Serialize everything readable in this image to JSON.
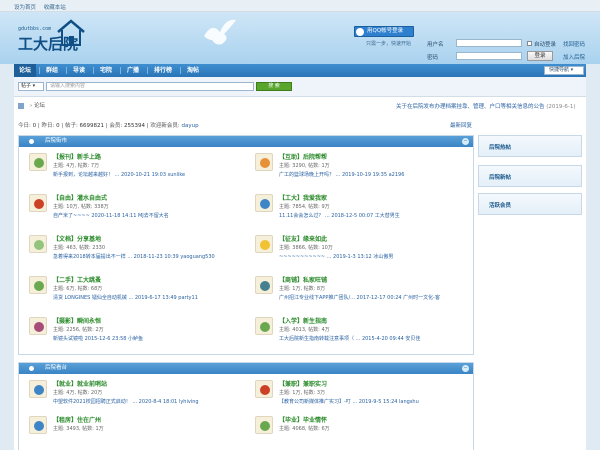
{
  "topbar": {
    "set_home": "设为首页",
    "add_fav": "收藏本站"
  },
  "logo": {
    "url": "gdutbbs.com",
    "name": "工大后院"
  },
  "login": {
    "qq_label": "用QQ帐号登录",
    "qq_sub": "只需一步，快速开始",
    "username_label": "用户名",
    "password_label": "密码",
    "auto_login": "自动登录",
    "find_password": "找回密码",
    "login_button": "登录",
    "join": "加入后院"
  },
  "nav": {
    "items": [
      "论坛",
      "群组",
      "导读",
      "宅院",
      "广播",
      "排行榜",
      "淘帖"
    ],
    "quick_nav": "快捷导航"
  },
  "search": {
    "type": "帖子",
    "placeholder": "请输入搜索内容",
    "button": "搜 索"
  },
  "breadcrumb": {
    "current": "论坛"
  },
  "notice": {
    "text": "关于在后院发布办理档案挂靠、管理、户口等相关信息的公告",
    "date": "(2019-6-1)"
  },
  "stats": {
    "today_label": "今日:",
    "today": "0",
    "yesterday_label": "昨日:",
    "yesterday": "0",
    "posts_label": "帖子:",
    "posts": "6699821",
    "members_label": "会员:",
    "members": "255394",
    "newest_label": "欢迎新会员:",
    "newest": "dayup"
  },
  "latest_posts": "最新回复",
  "section1": {
    "title": "后院街市",
    "forums": [
      {
        "name": "【报刊】新手上路",
        "topics": "4万",
        "posts": "7万",
        "last": "新手报到，论坛越来越好！ ... 2020-10-21 19:03 sunlike",
        "color": "#6aa84f"
      },
      {
        "name": "【互助】后院帮帮",
        "topics": "3290",
        "posts": "1万",
        "last": "广工的篮球场晚上开吗？ ... 2019-10-19 19:35 a2196",
        "color": "#e69138"
      },
      {
        "name": "【自由】灌水自由式",
        "topics": "10万",
        "posts": "338万",
        "last": "自产米了~~~~ 2020-11-18 14:11 MJ去不留大名",
        "color": "#cc4125"
      },
      {
        "name": "【工大】我爱我家",
        "topics": "7854",
        "posts": "9万",
        "last": "11.11会会怎么过？ ... 2018-12-5 00:07 工大替男生",
        "color": "#3d85c6"
      },
      {
        "name": "【文档】分享基地",
        "topics": "463",
        "posts": "2330",
        "last": "急着得来2018转本届提出不一样 ... 2018-11-23 10:39 yaoguang530",
        "color": "#93c47d"
      },
      {
        "name": "【征友】缘来如此",
        "topics": "3866",
        "posts": "10万",
        "last": "~~~~~~~~~~~ ... 2019-1-3 13:12 冰山傲男",
        "color": "#f1c232"
      },
      {
        "name": "【二手】工大跳蚤",
        "topics": "6万",
        "posts": "68万",
        "last": "清货 LONGINES 镭仙全自动机械 ... 2019-6-17 13:49 party11",
        "color": "#6aa84f"
      },
      {
        "name": "【商铺】私家旺铺",
        "topics": "1万",
        "posts": "8万",
        "last": "广州招江专业线下APP推广团队/... 2017-12-17 00:24 广州时一文化-客",
        "color": "#45818e"
      },
      {
        "name": "【摄影】瞬间永恒",
        "topics": "2256",
        "posts": "2万",
        "last": "新镜头试镜啦 2015-12-6 23:58 小鲈鱼",
        "color": "#a64d79"
      },
      {
        "name": "【入学】新生指南",
        "topics": "4013",
        "posts": "4万",
        "last": "工大后院新生指南转载注意事项（ ... 2015-4-20 09:44 安贝佳",
        "color": "#6aa84f"
      }
    ]
  },
  "section2": {
    "title": "后院看台",
    "forums": [
      {
        "name": "【就业】就业前哨站",
        "topics": "4万",
        "posts": "20万",
        "last": "中望软件2021校园招聘正式启动！ ... 2020-8-4 18:01 lyhiving",
        "color": "#3d85c6"
      },
      {
        "name": "【兼职】兼职实习",
        "topics": "1万",
        "posts": "3万",
        "last": "【教育公司新媒体推广实习】-叮 ... 2019-9-5 15:24 langshu",
        "color": "#cc4125"
      },
      {
        "name": "【租房】住在广州",
        "topics": "3493",
        "posts": "1万",
        "last": "",
        "color": "#3d85c6"
      },
      {
        "name": "【毕业】毕业情怀",
        "topics": "4068",
        "posts": "6万",
        "last": "",
        "color": "#6aa84f"
      }
    ]
  },
  "sidebar": {
    "hot": "后院热帖",
    "new": "后院新帖",
    "active": "活跃会员"
  },
  "labels": {
    "topics": "主题:",
    "posts": "帖数:"
  }
}
